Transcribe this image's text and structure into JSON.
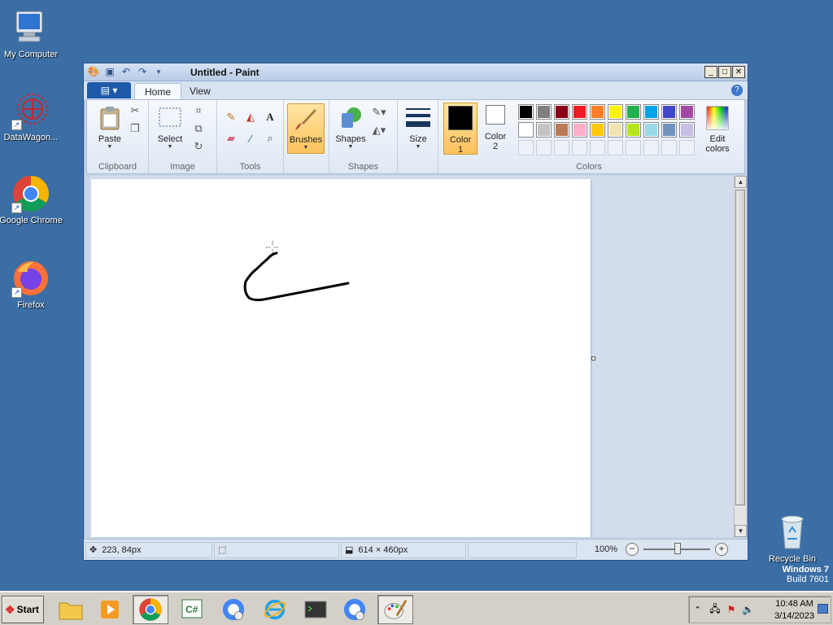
{
  "desktop": {
    "icons": [
      {
        "label": "My Computer"
      },
      {
        "label": "DataWagon..."
      },
      {
        "label": "Google Chrome"
      },
      {
        "label": "Firefox"
      },
      {
        "label": "Recycle Bin"
      }
    ],
    "watermark": {
      "line1": "Windows 7",
      "line2": "Build 7601"
    }
  },
  "window": {
    "title": "Untitled - Paint",
    "buttons": {
      "minimize": "_",
      "maximize": "□",
      "close": "✕"
    }
  },
  "ribbon": {
    "tabs": [
      {
        "label": "Home",
        "active": true
      },
      {
        "label": "View",
        "active": false
      }
    ],
    "groups": {
      "clipboard": {
        "label": "Clipboard",
        "paste": "Paste"
      },
      "image": {
        "label": "Image",
        "select": "Select"
      },
      "tools": {
        "label": "Tools"
      },
      "brushes": {
        "label": "Brushes"
      },
      "shapes": {
        "label": "Shapes",
        "button": "Shapes"
      },
      "size": {
        "label": "Size"
      },
      "colors": {
        "label": "Colors",
        "color1": {
          "label1": "Color",
          "label2": "1",
          "value": "#000000"
        },
        "color2": {
          "label1": "Color",
          "label2": "2",
          "value": "#ffffff"
        },
        "edit_label1": "Edit",
        "edit_label2": "colors",
        "palette_row1": [
          "#000000",
          "#7f7f7f",
          "#880015",
          "#ed1c24",
          "#ff7f27",
          "#fff200",
          "#22b14c",
          "#00a2e8",
          "#3f48cc",
          "#a349a4"
        ],
        "palette_row2": [
          "#ffffff",
          "#c3c3c3",
          "#b97a57",
          "#ffaec9",
          "#ffc90e",
          "#efe4b0",
          "#b5e61d",
          "#99d9ea",
          "#7092be",
          "#c8bfe7"
        ]
      }
    }
  },
  "canvas": {
    "stroke_color": "#000000"
  },
  "statusbar": {
    "cursor_pos": "223, 84px",
    "image_size": "614 × 460px",
    "zoom": "100%"
  },
  "taskbar": {
    "start_label": "Start",
    "clock_time": "10:48 AM",
    "clock_date": "3/14/2023"
  }
}
